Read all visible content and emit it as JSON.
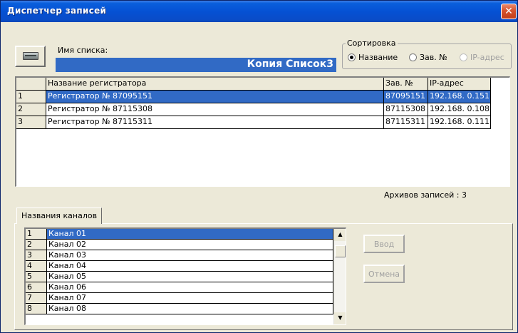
{
  "window": {
    "title": "Диспетчер записей",
    "close_glyph": "✕"
  },
  "list_name": {
    "label": "Имя списка:",
    "value": "Копия Список3"
  },
  "sort": {
    "title": "Сортировка",
    "options": [
      {
        "label": "Название",
        "selected": true,
        "enabled": true
      },
      {
        "label": "Зав. №",
        "selected": false,
        "enabled": true
      },
      {
        "label": "IP-адрес",
        "selected": false,
        "enabled": false
      }
    ]
  },
  "recorders": {
    "columns": [
      "Название регистратора",
      "Зав. №",
      "IP-адрес"
    ],
    "rows": [
      {
        "num": "1",
        "name": "Регистратор № 87095151",
        "serial": "87095151",
        "ip": "192.168.  0.151",
        "selected": true
      },
      {
        "num": "2",
        "name": "Регистратор № 87115308",
        "serial": "87115308",
        "ip": "192.168.  0.108",
        "selected": false
      },
      {
        "num": "3",
        "name": "Регистратор № 87115311",
        "serial": "87115311",
        "ip": "192.168.  0.111",
        "selected": false
      }
    ]
  },
  "archives": "Архивов записей : 3",
  "channels": {
    "tab_label": "Названия каналов",
    "rows": [
      {
        "num": "1",
        "name": "Канал 01",
        "selected": true
      },
      {
        "num": "2",
        "name": "Канал 02",
        "selected": false
      },
      {
        "num": "3",
        "name": "Канал 03",
        "selected": false
      },
      {
        "num": "4",
        "name": "Канал 04",
        "selected": false
      },
      {
        "num": "5",
        "name": "Канал 05",
        "selected": false
      },
      {
        "num": "6",
        "name": "Канал 06",
        "selected": false
      },
      {
        "num": "7",
        "name": "Канал 07",
        "selected": false
      },
      {
        "num": "8",
        "name": "Канал 08",
        "selected": false
      }
    ]
  },
  "buttons": {
    "enter": "Ввод",
    "cancel": "Отмена"
  },
  "colors": {
    "selection": "#316ac5",
    "titlebar": "#0551d4",
    "face": "#ece9d8"
  }
}
